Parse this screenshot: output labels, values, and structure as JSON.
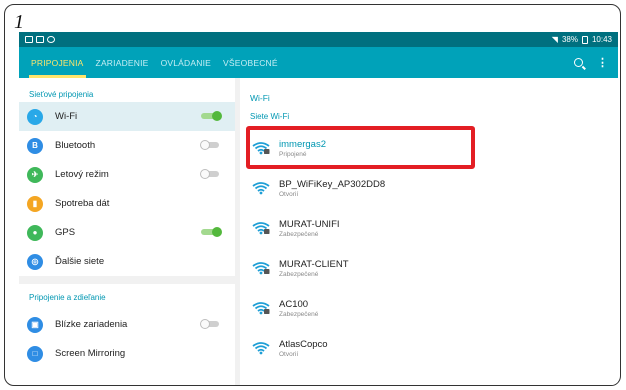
{
  "figure_number": "1",
  "status_bar": {
    "battery": "38%",
    "time": "10:43"
  },
  "tabs": [
    {
      "label": "PRIPOJENIA",
      "active": true
    },
    {
      "label": "ZARIADENIE",
      "active": false
    },
    {
      "label": "OVLÁDANIE",
      "active": false
    },
    {
      "label": "VŠEOBECNÉ",
      "active": false
    }
  ],
  "left": {
    "section1": "Sieťové pripojenia",
    "section2": "Pripojenie a zdieľanie",
    "items": [
      {
        "label": "Wi-Fi",
        "icon": "wifi-icon",
        "color": "#29a8e8",
        "toggle": "on"
      },
      {
        "label": "Bluetooth",
        "icon": "bluetooth-icon",
        "color": "#2f8de4",
        "toggle": "off"
      },
      {
        "label": "Letový režim",
        "icon": "airplane-icon",
        "color": "#3fb85a",
        "toggle": "off"
      },
      {
        "label": "Spotreba dát",
        "icon": "data-usage-icon",
        "color": "#f4a623",
        "toggle": "none"
      },
      {
        "label": "GPS",
        "icon": "location-icon",
        "color": "#3fb85a",
        "toggle": "on"
      },
      {
        "label": "Ďalšie siete",
        "icon": "more-networks-icon",
        "color": "#2f8de4",
        "toggle": "none"
      }
    ],
    "items2": [
      {
        "label": "Blízke zariadenia",
        "icon": "nearby-devices-icon",
        "color": "#2f8de4",
        "toggle": "off"
      },
      {
        "label": "Screen Mirroring",
        "icon": "screen-mirroring-icon",
        "color": "#2f8de4",
        "toggle": "none"
      }
    ]
  },
  "right": {
    "title": "Wi-Fi",
    "subtitle": "Siete Wi-Fi",
    "networks": [
      {
        "name": "immergas2",
        "status": "Pripojené",
        "connected": true,
        "locked": true
      },
      {
        "name": "BP_WiFiKey_AP302DD8",
        "status": "Otvorií",
        "connected": false,
        "locked": false
      },
      {
        "name": "MURAT-UNIFI",
        "status": "Zabezpečené",
        "connected": false,
        "locked": true
      },
      {
        "name": "MURAT-CLIENT",
        "status": "Zabezpečené",
        "connected": false,
        "locked": true
      },
      {
        "name": "AC100",
        "status": "Zabezpečené",
        "connected": false,
        "locked": true
      },
      {
        "name": "AtlasCopco",
        "status": "Otvorií",
        "connected": false,
        "locked": false
      }
    ]
  },
  "colors": {
    "statusbar": "#00707f",
    "tabbar": "#00a2b9",
    "active_tab": "#ffe56b",
    "accent": "#0097b2",
    "highlight": "#e31e24"
  }
}
